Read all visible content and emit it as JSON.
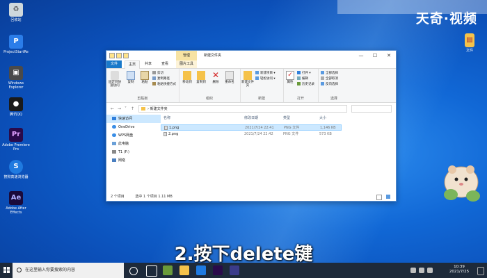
{
  "watermark": "天奇·视频",
  "subtitle": "2.按下delete键",
  "desktop_icons": [
    {
      "label": "回收站",
      "color": "#cfd8dc"
    },
    {
      "label": "ProjectStartRe",
      "color": "#2b7de9"
    },
    {
      "label": "Windows Explorer",
      "color": "#4a4a4a"
    },
    {
      "label": "腾讯QQ",
      "color": "#1a1a1a"
    },
    {
      "label": "Adobe Premiere Pro",
      "color": "#2a0a4a"
    },
    {
      "label": "搜狗高速浏览器",
      "color": "#1f7ae0"
    },
    {
      "label": "Adobe After Effects",
      "color": "#1a0a3a"
    }
  ],
  "desktop_right_icon": {
    "label": "文件"
  },
  "window": {
    "context_tab": "管理",
    "title": "新建文件夹",
    "controls": [
      "—",
      "☐",
      "✕"
    ],
    "tabs": [
      "文件",
      "主页",
      "共享",
      "查看",
      "图片工具"
    ],
    "ribbon": {
      "clipboard": {
        "pin": "固定到快速访问",
        "copy": "复制",
        "paste": "粘贴",
        "cut": "剪切",
        "copy_path": "复制路径",
        "paste_shortcut": "粘贴快捷方式",
        "label": "剪贴板"
      },
      "organize": {
        "move_to": "移动到",
        "copy_to": "复制到",
        "delete": "删除",
        "rename": "重命名",
        "label": "组织"
      },
      "new": {
        "new_folder": "新建文件夹",
        "new_item": "新建项目 ▾",
        "easy_access": "轻松访问 ▾",
        "label": "新建"
      },
      "open": {
        "properties": "属性",
        "open": "打开 ▾",
        "edit": "编辑",
        "history": "历史记录",
        "label": "打开"
      },
      "select": {
        "select_all": "全部选择",
        "select_none": "全部取消",
        "invert": "反向选择",
        "label": "选择"
      }
    },
    "address": {
      "nav": [
        "←",
        "→",
        "˅",
        "↑"
      ],
      "path": "› 新建文件夹"
    },
    "nav_pane": [
      {
        "label": "快速访问",
        "color": "#2f7fdc"
      },
      {
        "label": "OneDrive",
        "color": "#3a8ee6"
      },
      {
        "label": "WPS网盘",
        "color": "#3a8ee6"
      },
      {
        "label": "此电脑",
        "color": "#6aa0d8"
      },
      {
        "label": "T1 (F:)",
        "color": "#888888"
      },
      {
        "label": "网络",
        "color": "#4a7fc0"
      }
    ],
    "columns": [
      "名称",
      "修改日期",
      "类型",
      "大小"
    ],
    "files": [
      {
        "name": "1.png",
        "date": "2021/7/24 22:41",
        "type": "PNG 文件",
        "size": "1,146 KB",
        "selected": true
      },
      {
        "name": "2.png",
        "date": "2021/7/24 22:42",
        "type": "PNG 文件",
        "size": "573 KB",
        "selected": false
      }
    ],
    "status": {
      "count": "2 个项目",
      "selected": "选中 1 个项目  1.11 MB"
    }
  },
  "taskbar": {
    "search_placeholder": "在这里输入你要搜索的内容",
    "time": "10:39",
    "date": "2021/7/25"
  }
}
